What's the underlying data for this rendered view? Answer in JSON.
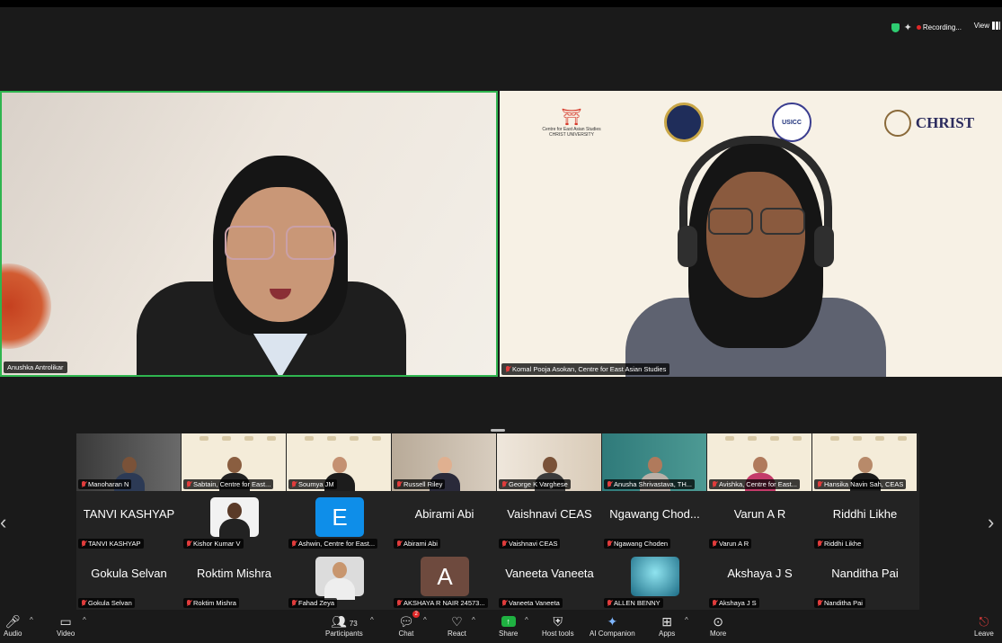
{
  "status": {
    "recording": "Recording...",
    "view": "View"
  },
  "main": {
    "left_name": "Anushka Antrolikar",
    "right_name": "Komal Pooja Asokan, Centre for East Asian Studies",
    "logos": {
      "ceas": "Centre for East Asian Studies",
      "ceas_sub": "CHRIST UNIVERSITY",
      "usicc": "USICC",
      "christ": "CHRIST"
    }
  },
  "gallery": {
    "row1": [
      {
        "name": "Manoharan N"
      },
      {
        "name": "Sabtain, Centre for East..."
      },
      {
        "name": "Soumya JM"
      },
      {
        "name": "Russell Riley"
      },
      {
        "name": "George K Varghese"
      },
      {
        "name": "Anusha Shrivastava, TH..."
      },
      {
        "name": "Avishka, Centre for East..."
      },
      {
        "name": "Hansika Navin Sah, CEAS"
      }
    ],
    "row2": [
      {
        "display": "TANVI KASHYAP",
        "name": "TANVI KASHYAP"
      },
      {
        "display": "",
        "name": "Kishor Kumar V"
      },
      {
        "display": "E",
        "name": "Ashwin, Centre for East..."
      },
      {
        "display": "Abirami Abi",
        "name": "Abirami Abi"
      },
      {
        "display": "Vaishnavi CEAS",
        "name": "Vaishnavi CEAS"
      },
      {
        "display": "Ngawang Chod...",
        "name": "Ngawang Choden"
      },
      {
        "display": "Varun A R",
        "name": "Varun A R"
      },
      {
        "display": "Riddhi Likhe",
        "name": "Riddhi Likhe"
      }
    ],
    "row3": [
      {
        "display": "Gokula Selvan",
        "name": "Gokula Selvan"
      },
      {
        "display": "Roktim Mishra",
        "name": "Roktim Mishra"
      },
      {
        "display": "",
        "name": "Fahad Zeya"
      },
      {
        "display": "A",
        "name": "AKSHAYA R NAIR 24573..."
      },
      {
        "display": "Vaneeta Vaneeta",
        "name": "Vaneeta Vaneeta"
      },
      {
        "display": "",
        "name": "ALLEN BENNY"
      },
      {
        "display": "Akshaya J S",
        "name": "Akshaya J S"
      },
      {
        "display": "Nanditha Pai",
        "name": "Nanditha Pai"
      }
    ]
  },
  "toolbar": {
    "audio": "Audio",
    "video": "Video",
    "participants": "Participants",
    "participants_count": "73",
    "chat": "Chat",
    "chat_badge": "2",
    "react": "React",
    "share": "Share",
    "host_tools": "Host tools",
    "ai_companion": "AI Companion",
    "apps": "Apps",
    "more": "More",
    "leave": "Leave"
  },
  "colors": {
    "active_speaker": "#2fb54f",
    "share": "#1fb141",
    "recording": "#e02828",
    "muted": "#e03c3c"
  }
}
